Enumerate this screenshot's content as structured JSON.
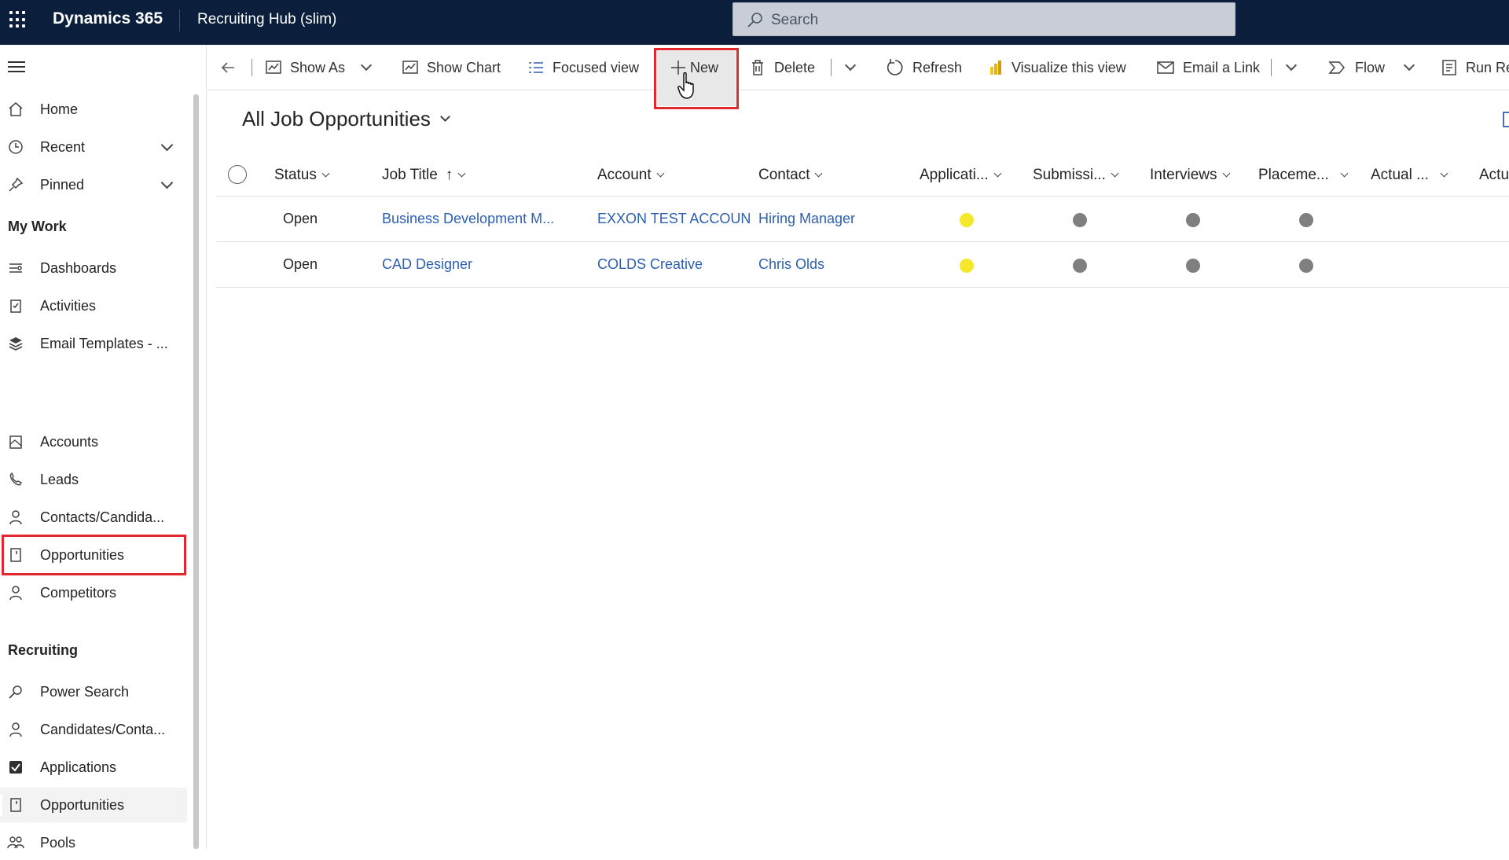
{
  "topbar": {
    "brand": "Dynamics 365",
    "app_name": "Recruiting Hub (slim)",
    "search_placeholder": "Search"
  },
  "command_bar": {
    "show_as": "Show As",
    "show_chart": "Show Chart",
    "focused_view": "Focused view",
    "new": "New",
    "delete": "Delete",
    "refresh": "Refresh",
    "visualize": "Visualize this view",
    "email_link": "Email a Link",
    "flow": "Flow",
    "run_report": "Run Re"
  },
  "sidebar": {
    "home": "Home",
    "recent": "Recent",
    "pinned": "Pinned",
    "my_work_section": "My Work",
    "my_work": [
      "Dashboards",
      "Activities",
      "Email Templates - ..."
    ],
    "accounts": "Accounts",
    "leads": "Leads",
    "contacts": "Contacts/Candida...",
    "opportunities": "Opportunities",
    "competitors": "Competitors",
    "recruiting_section": "Recruiting",
    "recruiting": [
      "Power Search",
      "Candidates/Conta...",
      "Applications",
      "Opportunities",
      "Pools"
    ]
  },
  "view": {
    "title": "All Job Opportunities"
  },
  "grid": {
    "columns": [
      "Status",
      "Job Title",
      "Account",
      "Contact",
      "Applicati...",
      "Submissi...",
      "Interviews",
      "Placeme...",
      "Actual ...",
      "Actu"
    ],
    "sort_indicator": "↑",
    "rows": [
      {
        "status": "Open",
        "job_title": "Business Development M...",
        "account": "EXXON TEST ACCOUN",
        "contact": "Hiring Manager",
        "indicators": [
          "yellow",
          "gray",
          "gray",
          "gray"
        ]
      },
      {
        "status": "Open",
        "job_title": "CAD Designer",
        "account": "COLDS Creative",
        "contact": "Chris Olds",
        "indicators": [
          "yellow",
          "gray",
          "gray",
          "gray"
        ]
      }
    ]
  },
  "colors": {
    "topbar": "#0b1e3c",
    "link": "#2b5fb3",
    "highlight_box": "#e0282e",
    "indicator_yellow": "#f5e72b",
    "indicator_gray": "#7f7f7f"
  }
}
